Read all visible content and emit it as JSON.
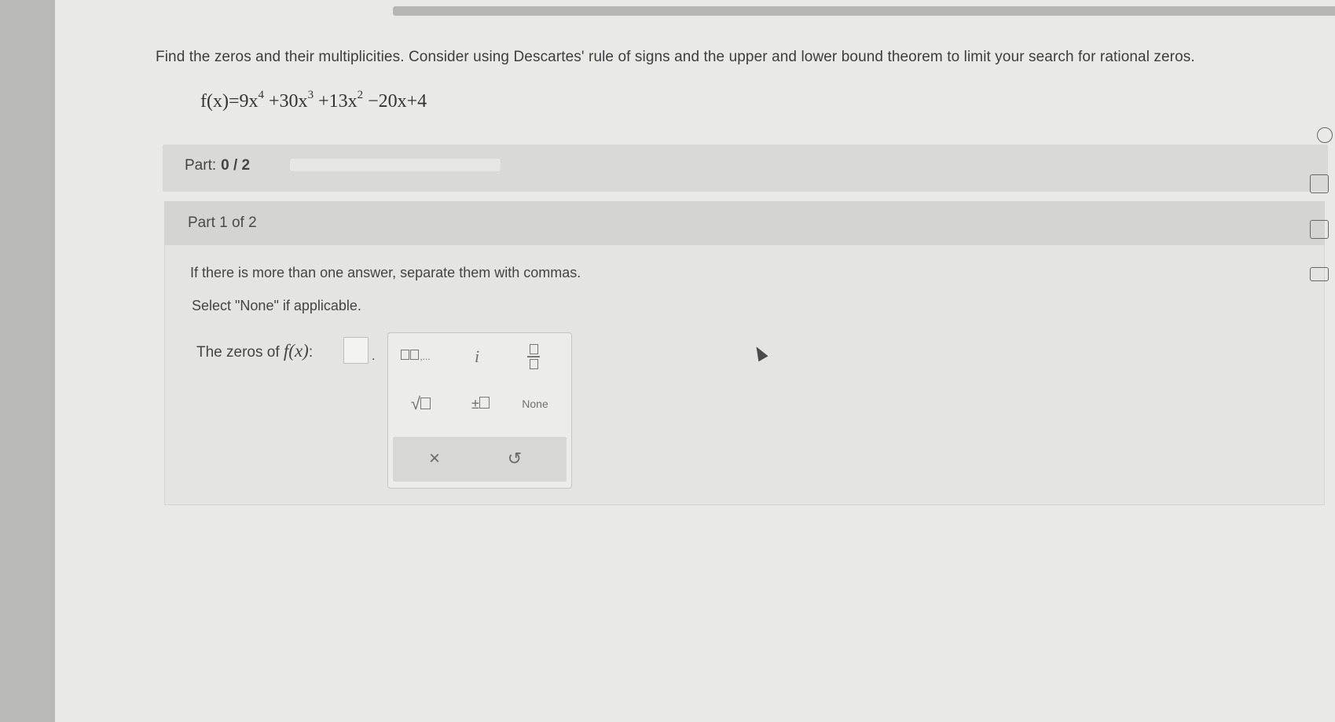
{
  "question": "Find the zeros and their multiplicities. Consider using Descartes' rule of signs and the upper and lower bound theorem to limit your search for rational zeros.",
  "equation": {
    "lhs": "f(x)=",
    "terms": [
      {
        "text": "9x",
        "exp": "4"
      },
      {
        "text": " +30x",
        "exp": "3"
      },
      {
        "text": " +13x",
        "exp": "2"
      },
      {
        "text": " −20x+4",
        "exp": ""
      }
    ]
  },
  "progress": {
    "label": "Part:",
    "value": "0 / 2",
    "fraction": 0
  },
  "part": {
    "header": "Part 1 of 2",
    "instruction1": "If there is more than one answer, separate them with commas.",
    "instruction2": "Select \"None\" if applicable.",
    "zeros_label": "The zeros of",
    "zeros_fx": "f(x)",
    "zeros_colon": ":",
    "answer_value": "",
    "answer_end": "."
  },
  "keypad": {
    "i_label": "i",
    "pm_label": "±",
    "none_label": "None",
    "clear_label": "×",
    "undo_label": "↺",
    "sqrt_label": "√"
  },
  "icons": [
    "multiple-answers-icon",
    "fraction-icon",
    "sqrt-icon",
    "plus-minus-icon",
    "clear-icon",
    "undo-icon",
    "mouse-cursor-icon",
    "help-icon",
    "calculator-icon",
    "grid-icon",
    "mail-icon"
  ]
}
